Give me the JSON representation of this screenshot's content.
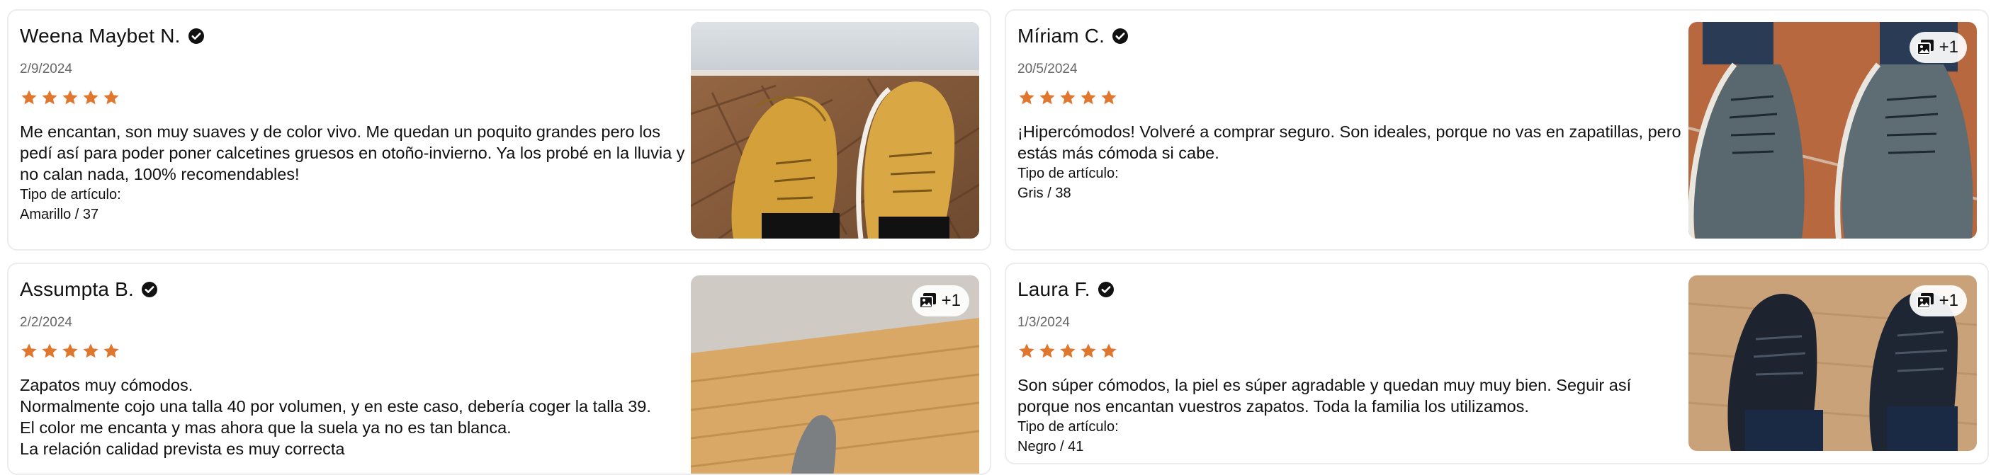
{
  "accent_star_color": "#e0772e",
  "reviews": [
    {
      "name": "Weena Maybet N.",
      "date": "2/9/2024",
      "rating": 5,
      "body": [
        "Me encantan, son muy suaves y de color vivo. Me quedan un poquito grandes pero los pedí así para poder poner calcetines gruesos en otoño-invierno. Ya los probé en la lluvia y no calan nada, 100% recomendables!"
      ],
      "item_label": "Tipo de artículo:",
      "item_value": "Amarillo / 37",
      "photo_badge": "",
      "photo_desc": "amarillo-boots"
    },
    {
      "name": "Míriam C.",
      "date": "20/5/2024",
      "rating": 5,
      "body": [
        "¡Hipercómodos! Volveré a comprar seguro. Son ideales, porque no vas en zapatillas, pero estás más cómoda si cabe."
      ],
      "item_label": "Tipo de artículo:",
      "item_value": "Gris / 38",
      "photo_badge": "+1",
      "photo_desc": "gris-boots"
    },
    {
      "name": "Assumpta B.",
      "date": "2/2/2024",
      "rating": 5,
      "body": [
        "Zapatos muy cómodos.",
        "Normalmente cojo una talla 40 por volumen, y en este caso, debería coger la talla 39.",
        "El color me encanta y mas ahora que la suela ya no es tan blanca.",
        "La relación calidad prevista es muy correcta"
      ],
      "item_label": "",
      "item_value": "",
      "photo_badge": "+1",
      "photo_desc": "grey-shoe-floor"
    },
    {
      "name": "Laura F.",
      "date": "1/3/2024",
      "rating": 5,
      "body": [
        "Son súper cómodos, la piel es súper agradable y quedan muy muy bien. Seguir así porque nos encantan vuestros zapatos. Toda la familia los utilizamos."
      ],
      "item_label": "Tipo de artículo:",
      "item_value": "Negro / 41",
      "photo_badge": "+1",
      "photo_desc": "negro-boots"
    }
  ]
}
